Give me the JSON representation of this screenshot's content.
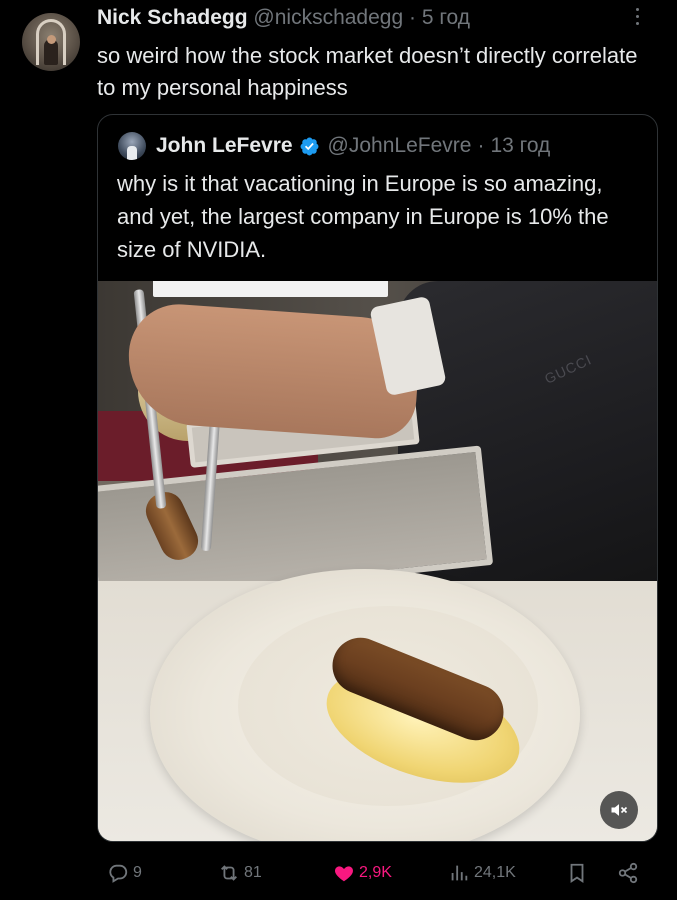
{
  "post": {
    "author_name": "Nick Schadegg",
    "author_handle": "@nickschadegg",
    "separator": "·",
    "time": "5 год",
    "text": "so weird how the stock market doesn’t directly correlate to my personal happiness"
  },
  "quoted": {
    "author_name": "John LeFevre",
    "author_handle": "@JohnLeFevre",
    "separator": "·",
    "time": "13 год",
    "text": "why is it that vacationing in Europe is so amazing, and yet, the largest company in Europe is 10% the size of NVIDIA.",
    "media_overlay_text": "GUCCI"
  },
  "actions": {
    "replies": "9",
    "reposts": "81",
    "likes": "2,9K",
    "views": "24,1K"
  },
  "colors": {
    "background": "#000000",
    "text": "#e7e9ea",
    "muted": "#71767b",
    "like": "#f91880",
    "verified": "#1d9bf0"
  }
}
